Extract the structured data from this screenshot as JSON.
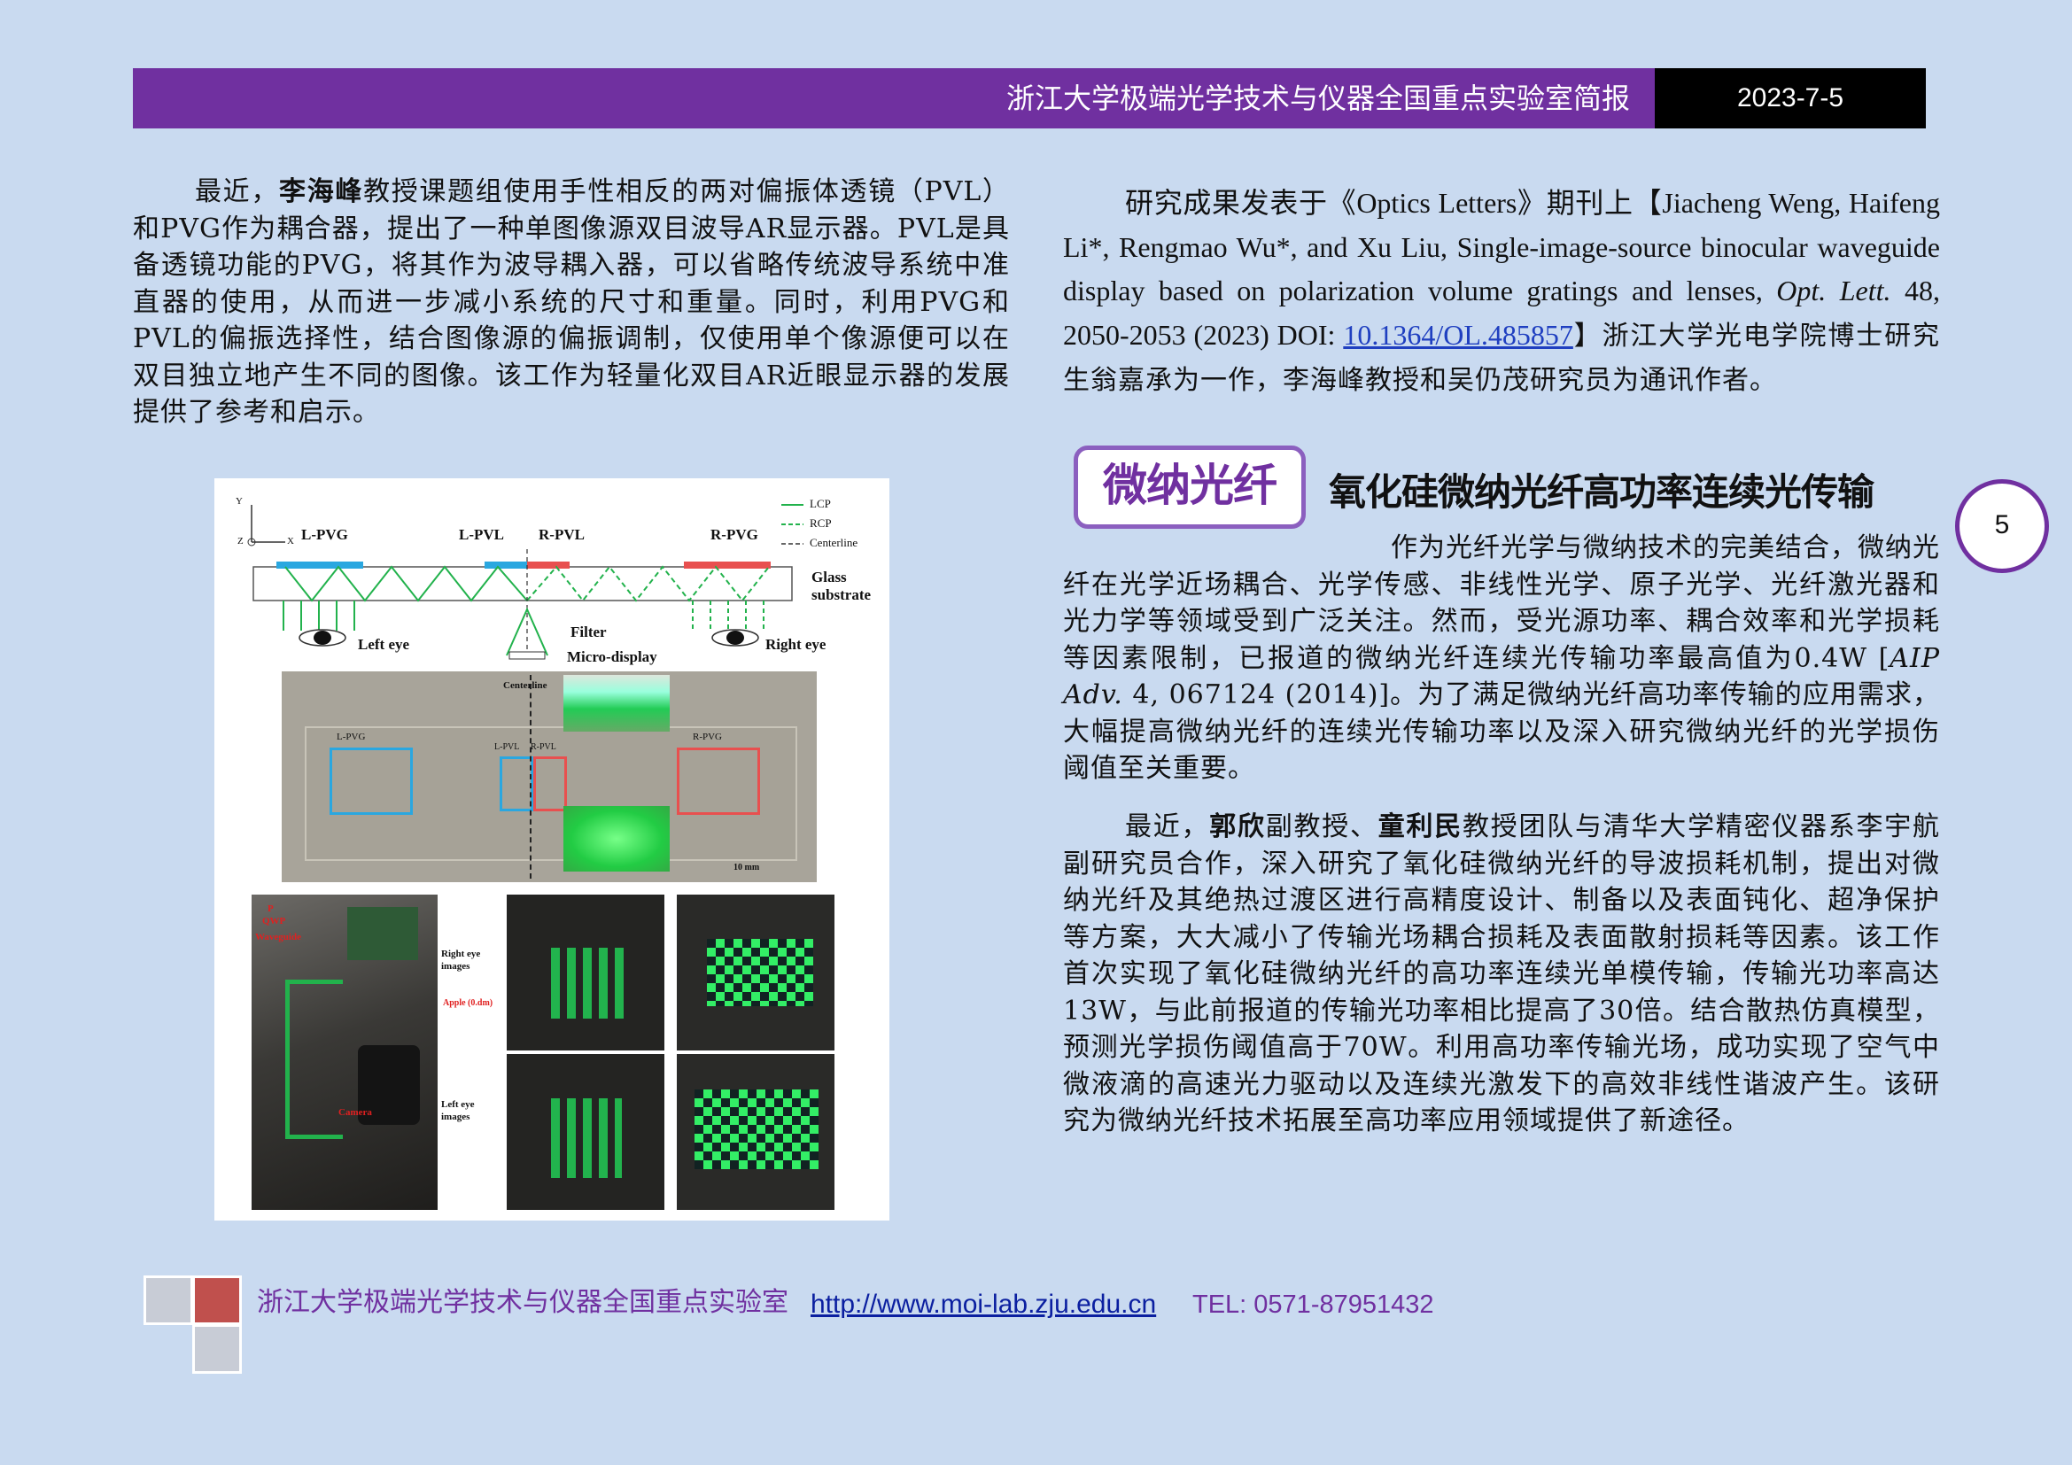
{
  "header": {
    "title": "浙江大学极端光学技术与仪器全国重点实验室简报",
    "date": "2023-7-5"
  },
  "left_paragraph": {
    "intro": "最近，",
    "name": "李海峰",
    "text": "教授课题组使用手性相反的两对偏振体透镜（PVL）和PVG作为耦合器，提出了一种单图像源双目波导AR显示器。PVL是具备透镜功能的PVG，将其作为波导耦入器，可以省略传统波导系统中准直器的使用，从而进一步减小系统的尺寸和重量。同时，利用PVG和PVL的偏振选择性，结合图像源的偏振调制，仅使用单个像源便可以在双目独立地产生不同的图像。该工作为轻量化双目AR近眼显示器的发展提供了参考和启示。"
  },
  "publication_paragraph": {
    "lead": "研究成果发表于《Optics Letters》期刊上【Jiacheng Weng, Haifeng Li*, Rengmao Wu*, and Xu Liu, Single-image-source binocular waveguide display based on polarization volume gratings and lenses, ",
    "journal": "Opt. Lett.",
    "ref": " 48, 2050-2053 (2023) DOI: ",
    "doi": "10.1364/OL.485857",
    "tail": "】浙江大学光电学院博士研究生翁嘉承为一作，李海峰教授和吴仍茂研究员为通讯作者。"
  },
  "section": {
    "badge": "微纳光纤",
    "title": "氧化硅微纳光纤高功率连续光传输"
  },
  "page_number": "5",
  "fiber_paragraph_1": {
    "text_a": "作为光纤光学与微纳技术的完美结合，微纳光纤在光学近场耦合、光学传感、非线性光学、原子光学、光纤激光器和光力学等领域受到广泛关注。然而，受光源功率、耦合效率和光学损耗等因素限制，已报道的微纳光纤连续光传输功率最高值为0.4W [",
    "journal": "AIP Adv.",
    "text_b": " 4, 067124 (2014)]。为了满足微纳光纤高功率传输的应用需求，大幅提高微纳光纤的连续光传输功率以及深入研究微纳光纤的光学损伤阈值至关重要。"
  },
  "fiber_paragraph_2": {
    "intro": "最近，",
    "name1": "郭欣",
    "mid1": "副教授、",
    "name2": "童利民",
    "text": "教授团队与清华大学精密仪器系李宇航副研究员合作，深入研究了氧化硅微纳光纤的导波损耗机制，提出对微纳光纤及其绝热过渡区进行高精度设计、制备以及表面钝化、超净保护等方案，大大减小了传输光场耦合损耗及表面散射损耗等因素。该工作首次实现了氧化硅微纳光纤的高功率连续光单模传输，传输光功率高达13W，与此前报道的传输光功率相比提高了30倍。结合散热仿真模型，预测光学损伤阈值高于70W。利用高功率传输光场，成功实现了空气中微液滴的高速光力驱动以及连续光激发下的高效非线性谐波产生。该研究为微纳光纤技术拓展至高功率应用领域提供了新途径。"
  },
  "figure": {
    "axis_y": "Y",
    "axis_z": "Z",
    "axis_x": "X",
    "l_pvg": "L-PVG",
    "l_pvl": "L-PVL",
    "r_pvl": "R-PVL",
    "r_pvg": "R-PVG",
    "legend_lcp": "LCP",
    "legend_rcp": "RCP",
    "legend_centerline": "Centerline",
    "glass": "Glass",
    "substrate": "substrate",
    "filter": "Filter",
    "micro_display": "Micro-display",
    "left_eye": "Left eye",
    "right_eye": "Right eye",
    "photo_centerline": "Centerline",
    "scale": "10 mm",
    "p": "P",
    "qwp": "QWP",
    "waveguide": "Waveguide",
    "right_eye_images": "Right eye images",
    "left_eye_images": "Left eye images",
    "apple": "Apple (0.dm)",
    "camera": "Camera",
    "colors": {
      "blue": "#2aa7e0",
      "red": "#e8504f",
      "green": "#22b24c"
    }
  },
  "footer": {
    "lab": "浙江大学极端光学技术与仪器全国重点实验室",
    "url": "http://www.moi-lab.zju.edu.cn",
    "tel": "TEL: 0571-87951432"
  },
  "colors": {
    "page_bg": "#c9daf0",
    "header_bar": "#7030a0",
    "date_box": "#000000",
    "accent_purple": "#7030a0",
    "link_blue": "#1f3fc0",
    "footer_red": "#c0504d",
    "footer_grey": "#c8ccd6"
  }
}
